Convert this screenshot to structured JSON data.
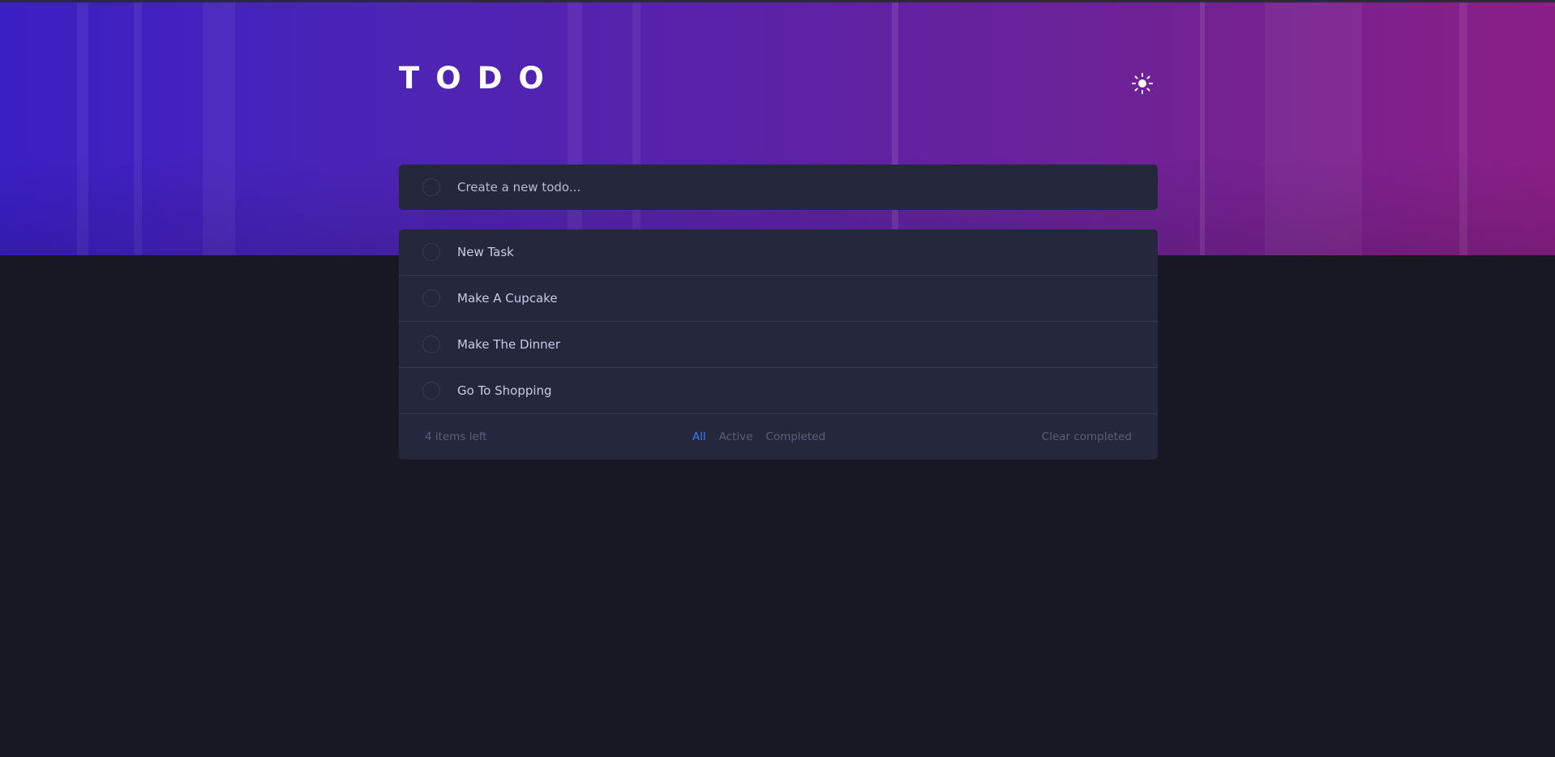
{
  "header": {
    "title": "TODO",
    "theme_icon": "sun-icon"
  },
  "new_todo": {
    "placeholder": "Create a new todo...",
    "value": ""
  },
  "todos": [
    {
      "text": "New Task",
      "completed": false
    },
    {
      "text": "Make A Cupcake",
      "completed": false
    },
    {
      "text": "Make The Dinner",
      "completed": false
    },
    {
      "text": "Go To Shopping",
      "completed": false
    }
  ],
  "footer": {
    "items_left": "4 items left",
    "filters": [
      "All",
      "Active",
      "Completed"
    ],
    "active_filter": "All",
    "clear_label": "Clear completed"
  },
  "colors": {
    "background": "#171823",
    "card": "#25273d",
    "text": "#c8cbe7",
    "muted": "#5b5e7e",
    "accent": "#3a7cfd",
    "gradient_start": "#3a1fc4",
    "gradient_end": "#8a1f86"
  }
}
